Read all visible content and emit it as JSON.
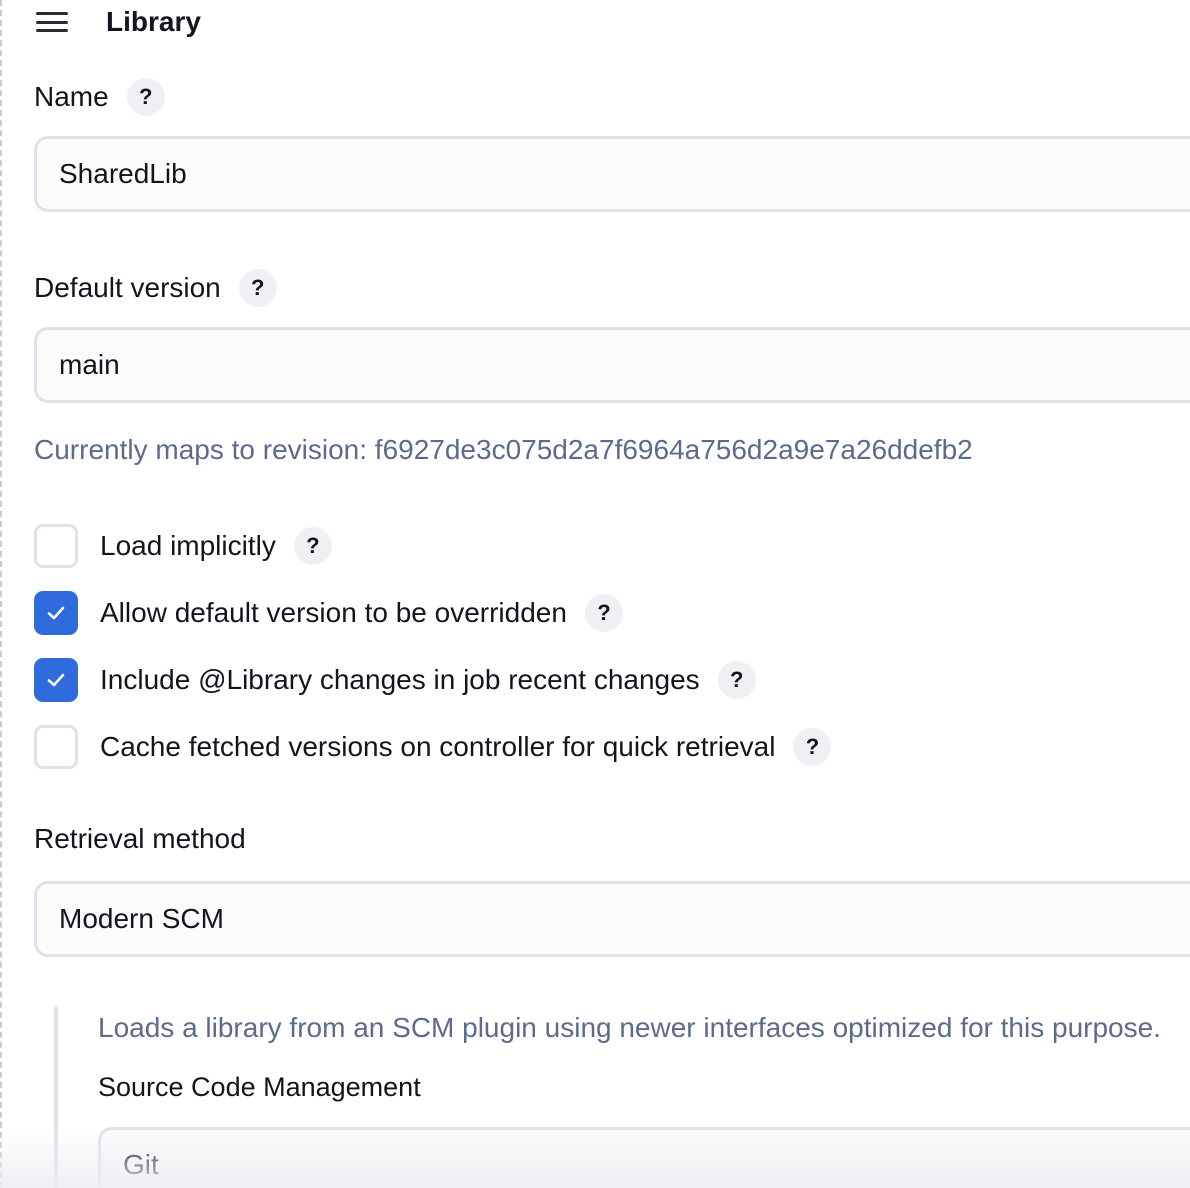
{
  "section": {
    "title": "Library",
    "handle_icon": "drag-handle-icon"
  },
  "fields": {
    "name": {
      "label": "Name",
      "value": "SharedLib",
      "help": "?"
    },
    "default_version": {
      "label": "Default version",
      "value": "main",
      "help": "?",
      "revision_hint": "Currently maps to revision: f6927de3c075d2a7f6964a756d2a9e7a26ddefb2"
    },
    "retrieval_method": {
      "label": "Retrieval method",
      "value": "Modern SCM",
      "description": "Loads a library from an SCM plugin using newer interfaces optimized for this purpose."
    },
    "source_code_management": {
      "label": "Source Code Management",
      "value": "Git"
    }
  },
  "options": [
    {
      "label": "Load implicitly",
      "checked": false,
      "help": "?"
    },
    {
      "label": "Allow default version to be overridden",
      "checked": true,
      "help": "?"
    },
    {
      "label": "Include @Library changes in job recent changes",
      "checked": true,
      "help": "?"
    },
    {
      "label": "Cache fetched versions on controller for quick retrieval",
      "checked": false,
      "help": "?"
    }
  ],
  "colors": {
    "accent": "#2f6bdc",
    "hint_text": "#5b6b8c",
    "border": "#dfe2ea"
  }
}
